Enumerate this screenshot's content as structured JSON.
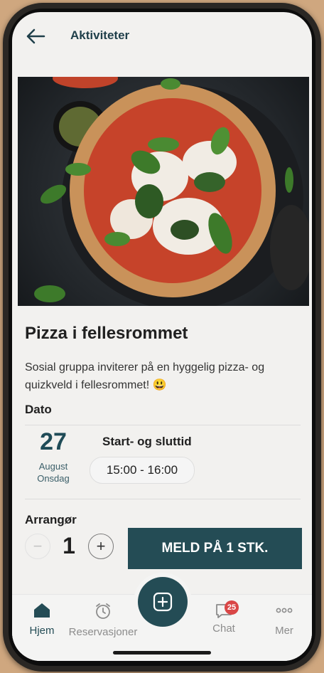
{
  "header": {
    "title": "Aktiviteter",
    "back_icon": "arrow-left-icon"
  },
  "event": {
    "title": "Pizza i fellesrommet",
    "description": "Sosial gruppa inviterer på en hyggelig pizza- og quizkveld i fellesrommet! 😃",
    "date_label": "Dato",
    "day": "27",
    "month": "August",
    "weekday": "Onsdag",
    "time_title": "Start- og sluttid",
    "time_range": "15:00 - 16:00",
    "organizer_label": "Arrangør"
  },
  "order": {
    "quantity": "1",
    "minus_symbol": "−",
    "plus_symbol": "+",
    "button_label": "MELD PÅ 1 STK."
  },
  "tabs": [
    {
      "label": "Hjem",
      "icon": "home-icon",
      "active": true
    },
    {
      "label": "Reservasjoner",
      "icon": "alarm-clock-icon",
      "active": false
    },
    {
      "label": "Chat",
      "icon": "chat-bubble-icon",
      "badge": "25",
      "active": false
    },
    {
      "label": "Mer",
      "icon": "more-dots-icon",
      "active": false
    }
  ],
  "colors": {
    "primary": "#244c55",
    "badge": "#d94646",
    "background": "#f2f1ef",
    "accent_text": "#1f4b57"
  }
}
